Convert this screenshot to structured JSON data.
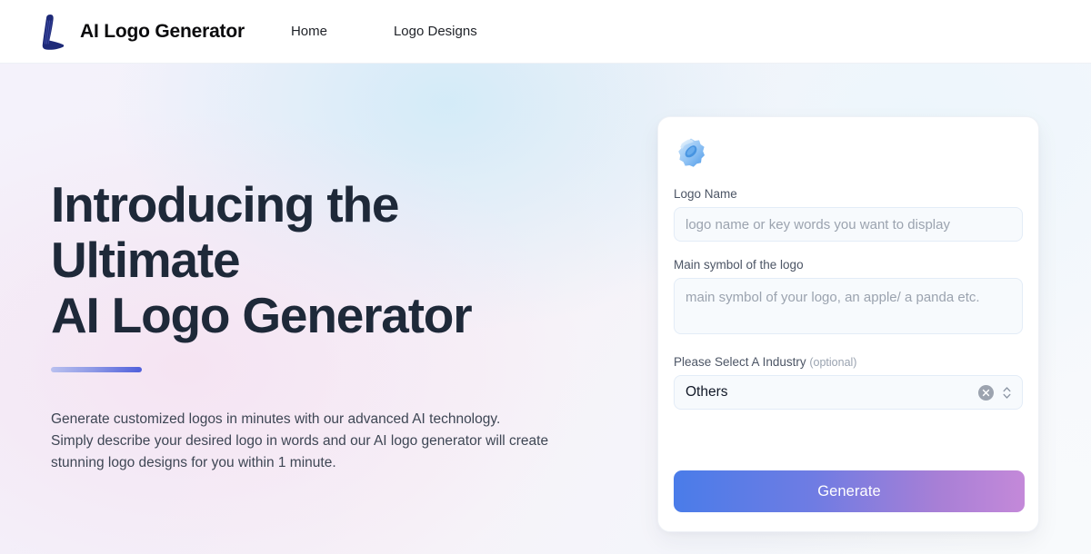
{
  "header": {
    "brand_title": "AI Logo Generator",
    "logo_icon": "stylized-letter-l-logo",
    "nav": [
      {
        "label": "Home"
      },
      {
        "label": "Logo Designs"
      }
    ]
  },
  "hero": {
    "headline_lines": [
      "Introducing the",
      "Ultimate",
      "AI Logo Generator"
    ],
    "paragraph_lines": [
      "Generate customized logos in minutes with our advanced AI technology.",
      "Simply describe your desired logo in words and our AI logo generator will create",
      "stunning logo designs for you within 1 minute."
    ]
  },
  "form": {
    "card_icon": "blue-rosette-badge-icon",
    "logo_name": {
      "label": "Logo Name",
      "placeholder": "logo name or key words you want to display",
      "value": ""
    },
    "main_symbol": {
      "label": "Main symbol of the logo",
      "placeholder": "main symbol of your logo, an apple/ a panda etc.",
      "value": ""
    },
    "industry": {
      "label": "Please Select A Industry",
      "optional_note": "(optional)",
      "selected": "Others",
      "clear_icon": "circle-x-clear-icon",
      "stepper_icon": "chevron-up-down-icon"
    },
    "generate_label": "Generate"
  },
  "colors": {
    "headline": "#1e2939",
    "brand_logo": "#1e2a78",
    "accent_bar_start": "#b9c0ef",
    "accent_bar_end": "#4f5fdb",
    "button_gradient_start": "#4a7ce9",
    "button_gradient_end": "#c489d9",
    "input_bg": "#f7fafd",
    "input_border": "#e3ecf7"
  }
}
